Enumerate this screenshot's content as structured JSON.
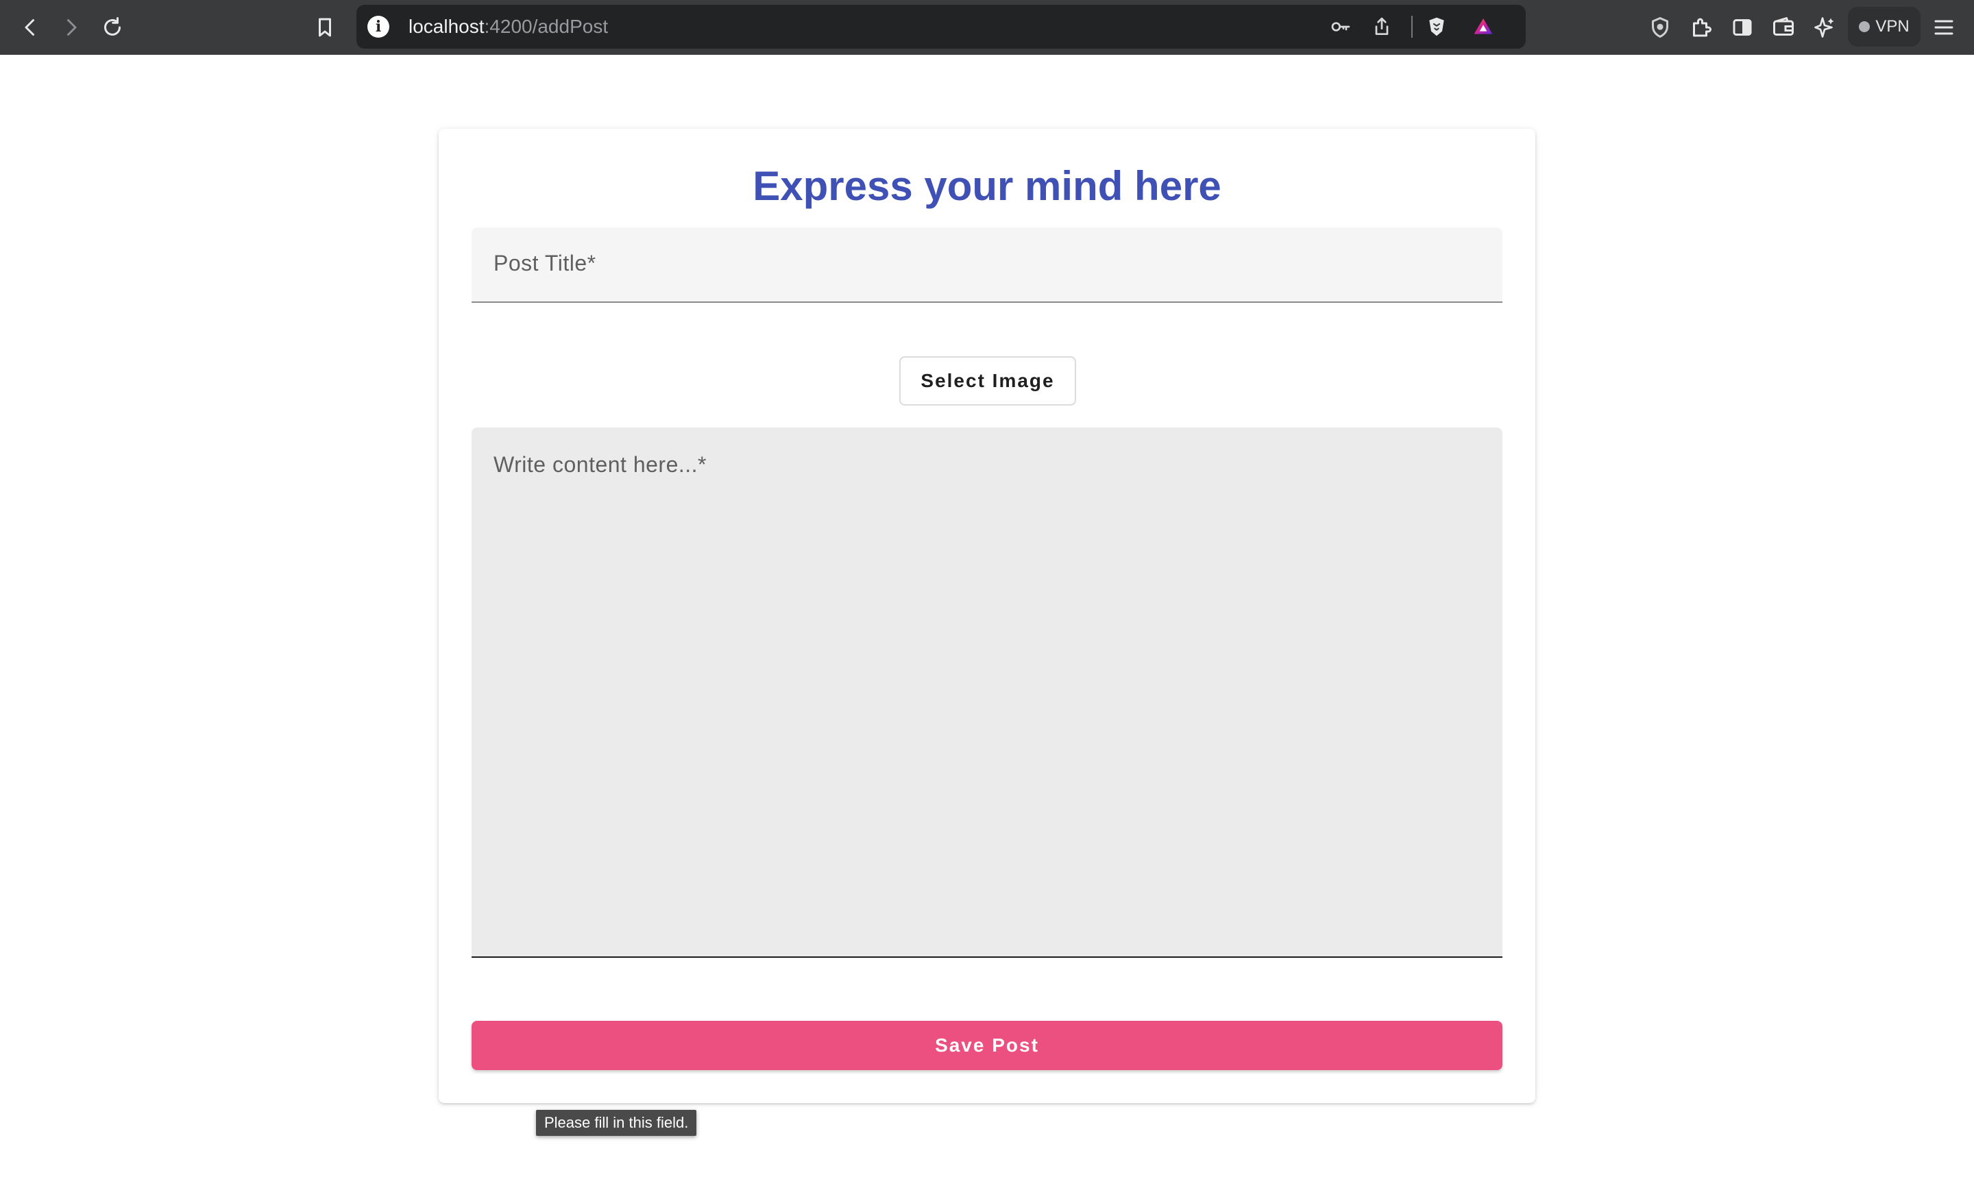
{
  "browser": {
    "url_host": "localhost",
    "url_path": ":4200/addPost",
    "vpn_label": "VPN",
    "icons": {
      "back": "back-arrow-icon",
      "forward": "forward-arrow-icon",
      "reload": "reload-icon",
      "bookmark": "bookmark-icon",
      "site_info": "info-icon",
      "password": "key-icon",
      "share": "share-icon",
      "brave_shields": "lion-shield-icon",
      "rewards": "triangle-rewards-icon",
      "vpn_shield": "shield-icon",
      "extensions": "puzzle-icon",
      "sidebar": "sidebar-icon",
      "wallet": "wallet-icon",
      "leo": "sparkle-icon",
      "menu": "hamburger-menu-icon"
    }
  },
  "form": {
    "title": "Express your mind here",
    "post_title_label": "Post Title*",
    "select_image_label": "Select Image",
    "content_label": "Write content here...*",
    "validation_tooltip": "Please fill in this field.",
    "save_label": "Save Post"
  },
  "colors": {
    "title": "#3f51b5",
    "save_button": "#ec5081",
    "chrome": "#3a3b3d",
    "urlbar": "#222325"
  }
}
